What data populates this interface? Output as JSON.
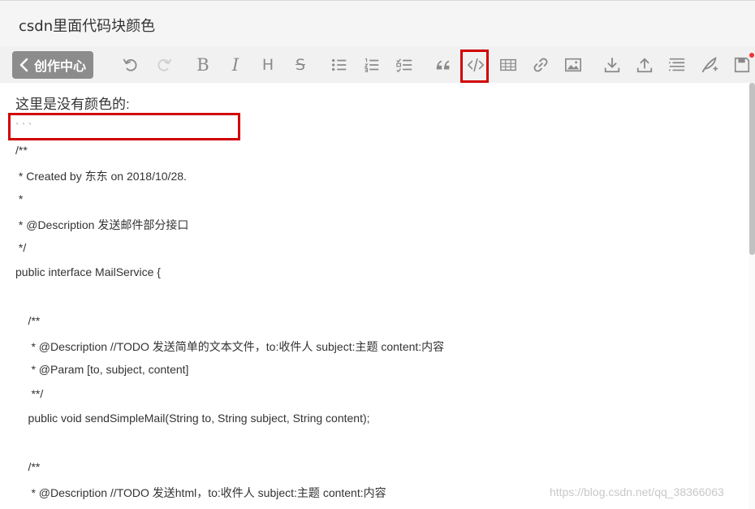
{
  "window": {
    "title": "csdn里面代码块颜色"
  },
  "toolbar": {
    "back_label": "创作中心",
    "buttons": [
      {
        "name": "undo-icon"
      },
      {
        "name": "redo-icon"
      },
      {
        "name": "bold-icon",
        "text": "B"
      },
      {
        "name": "italic-icon",
        "text": "I"
      },
      {
        "name": "heading-icon",
        "text": "H"
      },
      {
        "name": "strikethrough-icon",
        "text": "S"
      },
      {
        "name": "unordered-list-icon"
      },
      {
        "name": "ordered-list-icon"
      },
      {
        "name": "task-list-icon"
      },
      {
        "name": "quote-icon"
      },
      {
        "name": "code-block-icon"
      },
      {
        "name": "table-icon"
      },
      {
        "name": "link-icon"
      },
      {
        "name": "image-icon"
      },
      {
        "name": "download-icon"
      },
      {
        "name": "upload-icon"
      },
      {
        "name": "toc-icon"
      },
      {
        "name": "feather-icon"
      },
      {
        "name": "save-icon"
      }
    ]
  },
  "editor": {
    "heading": "这里是没有颜色的:",
    "backticks": "` ` `",
    "lines": [
      "/**",
      " * Created by 东东 on 2018/10/28.",
      " *",
      " * @Description 发送邮件部分接口",
      " */",
      "public interface MailService {",
      "",
      "    /**",
      "     * @Description //TODO 发送简单的文本文件，to:收件人 subject:主题 content:内容",
      "     * @Param [to, subject, content]",
      "     **/",
      "    public void sendSimpleMail(String to, String subject, String content);",
      "",
      "    /**",
      "     * @Description //TODO 发送html，to:收件人 subject:主题 content:内容"
    ]
  },
  "watermark": "https://blog.csdn.net/qq_38366063",
  "colors": {
    "highlight": "#d10000",
    "back_button_bg": "#8c8c8c",
    "toolbar_bg": "#f1f1f1"
  }
}
